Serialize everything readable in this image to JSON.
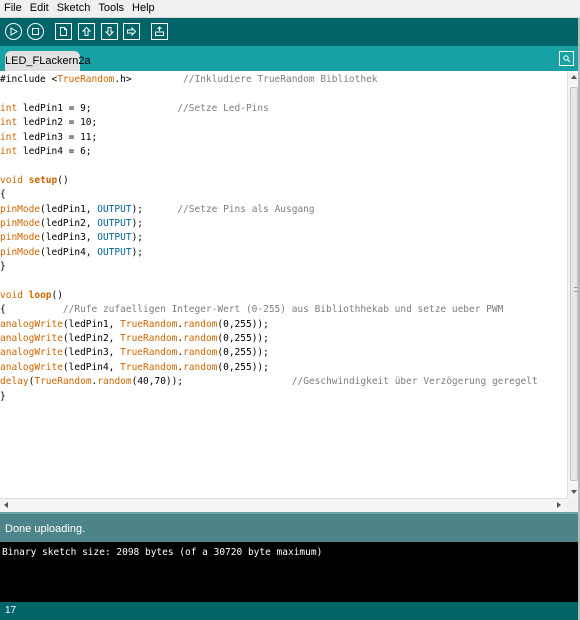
{
  "menu": {
    "items": [
      "File",
      "Edit",
      "Sketch",
      "Tools",
      "Help"
    ]
  },
  "toolbar": {
    "buttons": [
      {
        "name": "verify",
        "icon": "play-icon"
      },
      {
        "name": "stop",
        "icon": "stop-icon"
      },
      {
        "name": "new",
        "icon": "new-file-icon"
      },
      {
        "name": "open",
        "icon": "open-arrow-up-icon"
      },
      {
        "name": "save",
        "icon": "save-arrow-down-icon"
      },
      {
        "name": "upload",
        "icon": "upload-arrow-right-icon"
      },
      {
        "name": "serial-monitor",
        "icon": "serial-monitor-icon"
      }
    ]
  },
  "tab": {
    "label": "LED_FLackern2a"
  },
  "editor": {
    "lines": [
      [
        [
          "plain",
          "#include <"
        ],
        [
          "keyword",
          "TrueRandom"
        ],
        [
          "plain",
          ".h>         "
        ],
        [
          "comment",
          "//Inkludiere TrueRandom Bibliothek"
        ]
      ],
      [],
      [
        [
          "keyword",
          "int"
        ],
        [
          "plain",
          " ledPin1 = 9;               "
        ],
        [
          "comment",
          "//Setze Led-Pins"
        ]
      ],
      [
        [
          "keyword",
          "int"
        ],
        [
          "plain",
          " ledPin2 = 10;"
        ]
      ],
      [
        [
          "keyword",
          "int"
        ],
        [
          "plain",
          " ledPin3 = 11;"
        ]
      ],
      [
        [
          "keyword",
          "int"
        ],
        [
          "plain",
          " ledPin4 = 6;"
        ]
      ],
      [],
      [
        [
          "keyword",
          "void"
        ],
        [
          "plain",
          " "
        ],
        [
          "keyword2",
          "setup"
        ],
        [
          "plain",
          "()"
        ]
      ],
      [
        [
          "plain",
          "{"
        ]
      ],
      [
        [
          "keyword",
          "pinMode"
        ],
        [
          "plain",
          "(ledPin1, "
        ],
        [
          "constant",
          "OUTPUT"
        ],
        [
          "plain",
          ");      "
        ],
        [
          "comment",
          "//Setze Pins als Ausgang"
        ]
      ],
      [
        [
          "keyword",
          "pinMode"
        ],
        [
          "plain",
          "(ledPin2, "
        ],
        [
          "constant",
          "OUTPUT"
        ],
        [
          "plain",
          ");"
        ]
      ],
      [
        [
          "keyword",
          "pinMode"
        ],
        [
          "plain",
          "(ledPin3, "
        ],
        [
          "constant",
          "OUTPUT"
        ],
        [
          "plain",
          ");"
        ]
      ],
      [
        [
          "keyword",
          "pinMode"
        ],
        [
          "plain",
          "(ledPin4, "
        ],
        [
          "constant",
          "OUTPUT"
        ],
        [
          "plain",
          ");"
        ]
      ],
      [
        [
          "plain",
          "}"
        ]
      ],
      [],
      [
        [
          "keyword",
          "void"
        ],
        [
          "plain",
          " "
        ],
        [
          "keyword2",
          "loop"
        ],
        [
          "plain",
          "()"
        ]
      ],
      [
        [
          "plain",
          "{          "
        ],
        [
          "comment",
          "//Rufe zufaelligen Integer-Wert (0-255) aus Bibliothhekab und setze ueber PWM"
        ]
      ],
      [
        [
          "keyword",
          "analogWrite"
        ],
        [
          "plain",
          "(ledPin1, "
        ],
        [
          "keyword",
          "TrueRandom"
        ],
        [
          "plain",
          "."
        ],
        [
          "keyword",
          "random"
        ],
        [
          "plain",
          "(0,255));"
        ]
      ],
      [
        [
          "keyword",
          "analogWrite"
        ],
        [
          "plain",
          "(ledPin2, "
        ],
        [
          "keyword",
          "TrueRandom"
        ],
        [
          "plain",
          "."
        ],
        [
          "keyword",
          "random"
        ],
        [
          "plain",
          "(0,255));"
        ]
      ],
      [
        [
          "keyword",
          "analogWrite"
        ],
        [
          "plain",
          "(ledPin3, "
        ],
        [
          "keyword",
          "TrueRandom"
        ],
        [
          "plain",
          "."
        ],
        [
          "keyword",
          "random"
        ],
        [
          "plain",
          "(0,255));"
        ]
      ],
      [
        [
          "keyword",
          "analogWrite"
        ],
        [
          "plain",
          "(ledPin4, "
        ],
        [
          "keyword",
          "TrueRandom"
        ],
        [
          "plain",
          "."
        ],
        [
          "keyword",
          "random"
        ],
        [
          "plain",
          "(0,255));"
        ]
      ],
      [
        [
          "keyword",
          "delay"
        ],
        [
          "plain",
          "("
        ],
        [
          "keyword",
          "TrueRandom"
        ],
        [
          "plain",
          "."
        ],
        [
          "keyword",
          "random"
        ],
        [
          "plain",
          "(40,70));                   "
        ],
        [
          "comment",
          "//Geschwindigkeit über Verzögerung geregelt"
        ]
      ],
      [
        [
          "plain",
          "}"
        ]
      ]
    ]
  },
  "status": {
    "message": "Done uploading."
  },
  "console": {
    "output": "Binary sketch size: 2098 bytes (of a 30720 byte maximum)"
  },
  "footer": {
    "line_number": "17"
  },
  "colors": {
    "toolbar": "#006468",
    "tabstrip": "#17a1a5",
    "statusbar": "#4c848a",
    "keyword": "#cc6600",
    "constant": "#006699",
    "comment": "#7e7e7e"
  }
}
